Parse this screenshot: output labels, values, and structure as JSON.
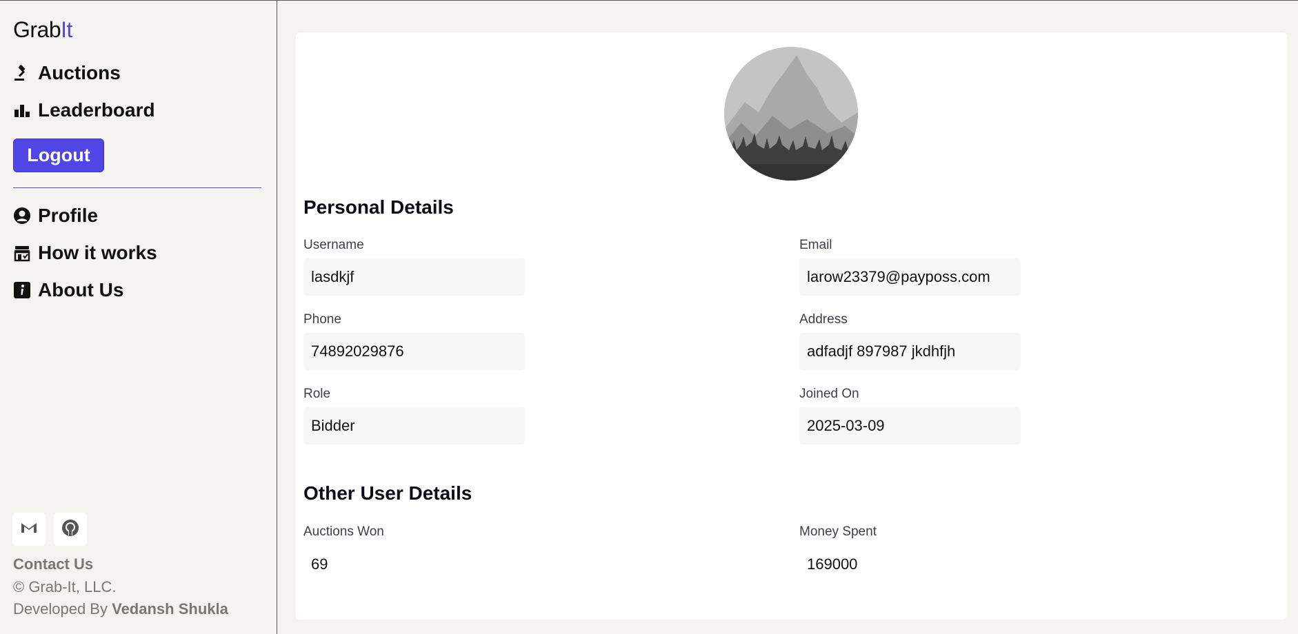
{
  "app": {
    "logo_main": "Grab",
    "logo_accent": "It",
    "accent_color": "#4f46e5"
  },
  "sidebar": {
    "nav_top": [
      {
        "label": "Auctions",
        "icon": "gavel-icon"
      },
      {
        "label": "Leaderboard",
        "icon": "bar-chart-icon"
      }
    ],
    "logout_label": "Logout",
    "nav_bottom": [
      {
        "label": "Profile",
        "icon": "user-circle-icon"
      },
      {
        "label": "How it works",
        "icon": "store-icon"
      },
      {
        "label": "About Us",
        "icon": "info-icon"
      }
    ],
    "social": [
      {
        "icon": "gmail-icon"
      },
      {
        "icon": "github-icon"
      }
    ],
    "contact_label": "Contact Us",
    "copyright": "© Grab-It, LLC.",
    "developed_by_prefix": "Developed By",
    "developer_name": "Vedansh Shukla"
  },
  "profile": {
    "personal_title": "Personal Details",
    "fields": {
      "username": {
        "label": "Username",
        "value": "lasdkjf"
      },
      "email": {
        "label": "Email",
        "value": "larow23379@payposs.com"
      },
      "phone": {
        "label": "Phone",
        "value": "74892029876"
      },
      "address": {
        "label": "Address",
        "value": "adfadjf 897987 jkdhfjh"
      },
      "role": {
        "label": "Role",
        "value": "Bidder"
      },
      "joined": {
        "label": "Joined On",
        "value": "2025-03-09"
      }
    },
    "other_title": "Other User Details",
    "other": {
      "auctions_won": {
        "label": "Auctions Won",
        "value": "69"
      },
      "money_spent": {
        "label": "Money Spent",
        "value": "169000"
      }
    }
  }
}
